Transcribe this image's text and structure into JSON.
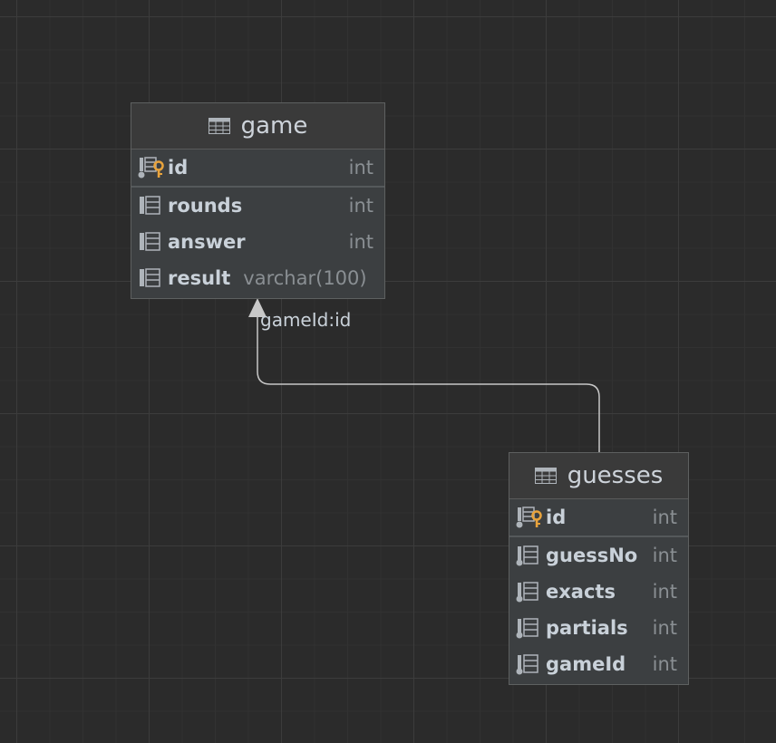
{
  "entities": [
    {
      "name": "game",
      "columns": [
        {
          "name": "id",
          "type": "int",
          "primary_key": true
        },
        {
          "name": "rounds",
          "type": "int"
        },
        {
          "name": "answer",
          "type": "int"
        },
        {
          "name": "result",
          "type": "varchar(100)"
        }
      ]
    },
    {
      "name": "guesses",
      "columns": [
        {
          "name": "id",
          "type": "int",
          "primary_key": true
        },
        {
          "name": "guessNo",
          "type": "int"
        },
        {
          "name": "exacts",
          "type": "int"
        },
        {
          "name": "partials",
          "type": "int"
        },
        {
          "name": "gameId",
          "type": "int"
        }
      ]
    }
  ],
  "relationships": [
    {
      "from": "guesses",
      "to": "game",
      "label": "gameId:id"
    }
  ],
  "colors": {
    "background": "#2b2b2b",
    "entity_fill": "#3c3f41",
    "key_icon": "#e8a33c",
    "connector": "#c8c8c8"
  }
}
